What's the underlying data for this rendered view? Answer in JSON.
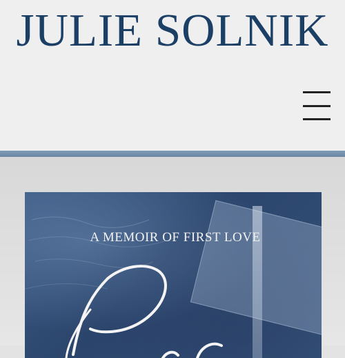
{
  "site": {
    "logo_text": "JULIE SOLNIK"
  },
  "header": {
    "menu_icon": "hamburger-menu-icon"
  },
  "book": {
    "subtitle": "A MEMOIR OF FIRST LOVE",
    "title_partial": "Paris"
  },
  "colors": {
    "brand": "#1c3f66",
    "band": "#7f9ab5",
    "cover_bg": "#2f4b72"
  }
}
